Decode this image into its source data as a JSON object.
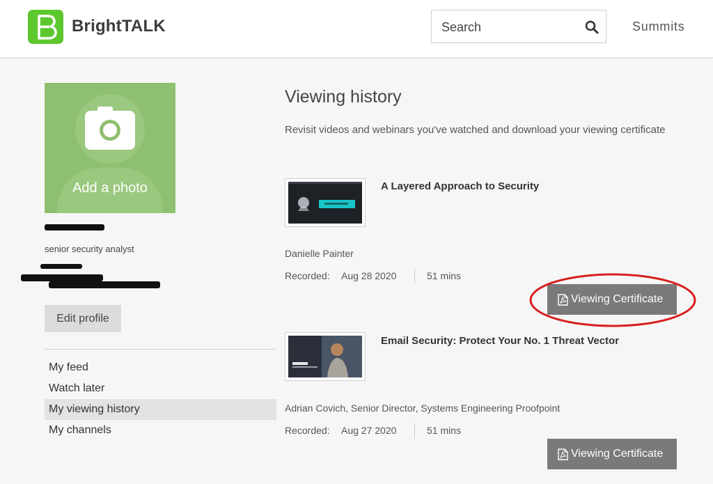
{
  "header": {
    "brand": "BrightTALK",
    "logo_letter": "B",
    "search_placeholder": "Search",
    "summits_label": "Summits"
  },
  "colors": {
    "brand_green": "#5cc82e",
    "avatar_green": "#8fbf70",
    "cert_button": "#7a7a7a",
    "annotation_red": "#d81e1e"
  },
  "profile": {
    "add_photo_label": "Add a photo",
    "job_title": "senior security analyst",
    "edit_profile_label": "Edit profile"
  },
  "sidebar": {
    "items": [
      {
        "label": "My feed",
        "active": false
      },
      {
        "label": "Watch later",
        "active": false
      },
      {
        "label": "My viewing history",
        "active": true
      },
      {
        "label": "My channels",
        "active": false
      }
    ]
  },
  "main": {
    "title": "Viewing history",
    "description": "Revisit videos and webinars you've watched and download your viewing certificate",
    "videos": [
      {
        "title": "A Layered Approach to Security",
        "presenter": "Danielle Painter",
        "recorded_label": "Recorded:",
        "recorded_date": "Aug 28 2020",
        "duration": "51 mins",
        "certificate_label": "Viewing Certificate"
      },
      {
        "title": "Email Security: Protect Your No. 1 Threat Vector",
        "presenter": "Adrian Covich, Senior Director, Systems Engineering Proofpoint",
        "recorded_label": "Recorded:",
        "recorded_date": "Aug 27 2020",
        "duration": "51 mins",
        "certificate_label": "Viewing Certificate"
      }
    ]
  },
  "icons": [
    "brighttalk-logo-icon",
    "search-icon",
    "camera-icon",
    "pdf-icon"
  ]
}
